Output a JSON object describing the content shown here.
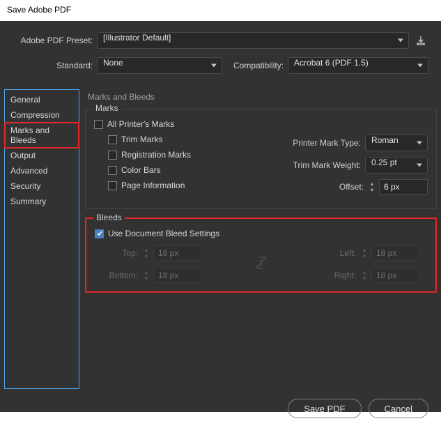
{
  "window": {
    "title": "Save Adobe PDF"
  },
  "preset": {
    "label": "Adobe PDF Preset:",
    "value": "[Illustrator Default]"
  },
  "standard": {
    "label": "Standard:",
    "value": "None"
  },
  "compatibility": {
    "label": "Compatibility:",
    "value": "Acrobat 6 (PDF 1.5)"
  },
  "sidebar": {
    "items": [
      {
        "label": "General"
      },
      {
        "label": "Compression"
      },
      {
        "label": "Marks and Bleeds",
        "selected": true
      },
      {
        "label": "Output"
      },
      {
        "label": "Advanced"
      },
      {
        "label": "Security"
      },
      {
        "label": "Summary"
      }
    ]
  },
  "panel": {
    "title": "Marks and Bleeds"
  },
  "marks": {
    "group_title": "Marks",
    "all": "All Printer's Marks",
    "trim": "Trim Marks",
    "registration": "Registration Marks",
    "color_bars": "Color Bars",
    "page_info": "Page Information",
    "printer_mark_type_label": "Printer Mark Type:",
    "printer_mark_type_value": "Roman",
    "trim_weight_label": "Trim Mark Weight:",
    "trim_weight_value": "0.25 pt",
    "offset_label": "Offset:",
    "offset_value": "6 px"
  },
  "bleeds": {
    "group_title": "Bleeds",
    "use_document": "Use Document Bleed Settings",
    "top_label": "Top:",
    "top_value": "18 px",
    "bottom_label": "Bottom:",
    "bottom_value": "18 px",
    "left_label": "Left:",
    "left_value": "18 px",
    "right_label": "Right:",
    "right_value": "18 px"
  },
  "footer": {
    "save": "Save PDF",
    "cancel": "Cancel"
  }
}
